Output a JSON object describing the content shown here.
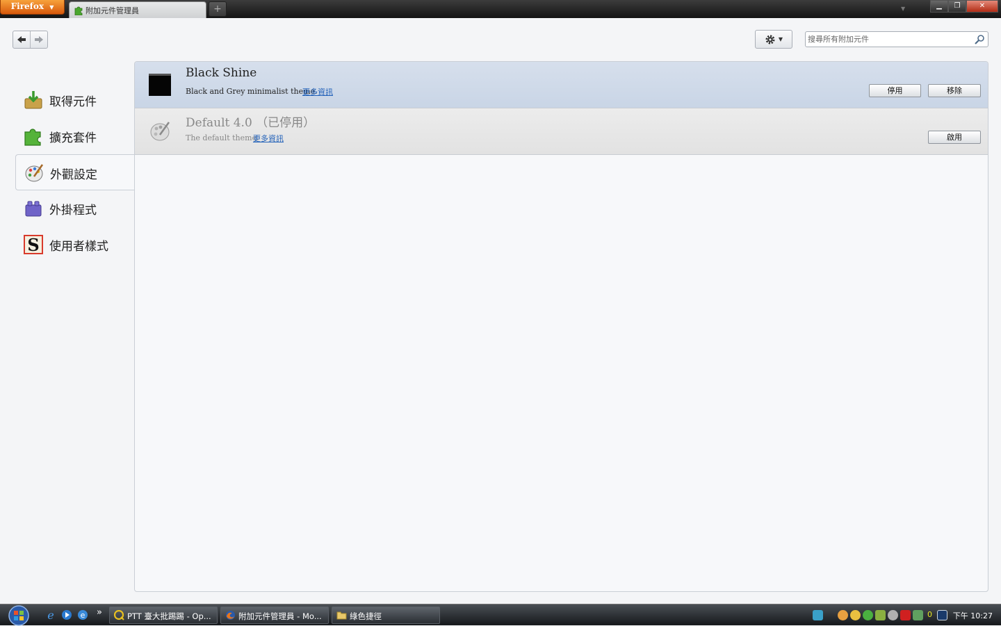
{
  "browser": {
    "menu_button": "Firefox",
    "tab_title": "附加元件管理員",
    "new_tab": "+",
    "win_min": "▁",
    "win_max": "❐",
    "win_close": "✕"
  },
  "toolbar": {
    "search_placeholder": "搜尋所有附加元件"
  },
  "sidebar": {
    "items": [
      {
        "label": "取得元件",
        "icon": "download-box-icon"
      },
      {
        "label": "擴充套件",
        "icon": "puzzle-piece-icon"
      },
      {
        "label": "外觀設定",
        "icon": "palette-icon",
        "selected": true
      },
      {
        "label": "外掛程式",
        "icon": "lego-block-icon"
      },
      {
        "label": "使用者樣式",
        "icon": "stylish-s-icon"
      }
    ]
  },
  "addons": [
    {
      "name": "Black Shine",
      "description": "Black and Grey minimalist theme.",
      "more": "更多資訊",
      "buttons": [
        "停用",
        "移除"
      ]
    },
    {
      "name": "Default  4.0  （已停用）",
      "description": "The default theme.",
      "more": "更多資訊",
      "buttons": [
        "啟用"
      ]
    }
  ],
  "taskbar": {
    "quicklaunch_more": "»",
    "tasks": [
      {
        "label": "PTT 臺大批踢踢 - Op..."
      },
      {
        "label": "附加元件管理員 - Mo..."
      },
      {
        "label": "綠色捷徑"
      }
    ],
    "tray_counter": "0",
    "clock": "下午 10:27"
  },
  "colors": {
    "firefox_orange": "#e8761c",
    "selected_row": "#cdd8e8",
    "link": "#1f5fb8"
  }
}
